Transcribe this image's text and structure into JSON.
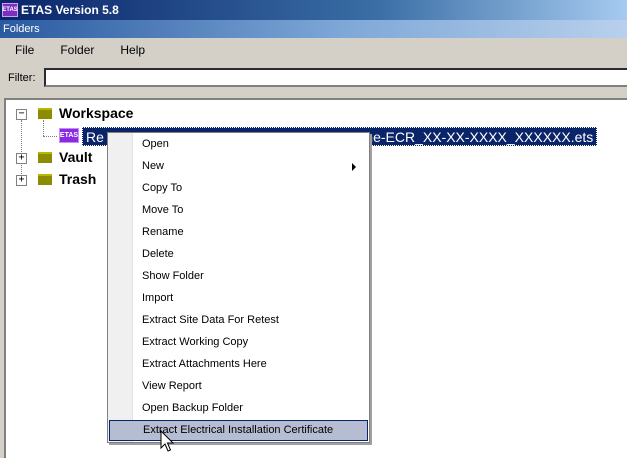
{
  "window": {
    "title": "ETAS Version 5.8",
    "logo_text": "ETAS"
  },
  "panel": {
    "title": "Folders"
  },
  "menu": {
    "items": [
      "File",
      "Folder",
      "Help"
    ]
  },
  "filter": {
    "label": "Filter:",
    "value": "",
    "placeholder": ""
  },
  "tree": {
    "workspace": {
      "label": "Workspace",
      "expander": "−"
    },
    "selected_file": {
      "icon_text": "ETAS",
      "label": "Re                                                              ourne-ECR_XX-XX-XXXX_XXXXXX.ets"
    },
    "vault": {
      "label": "Vault",
      "expander": "+"
    },
    "trash": {
      "label": "Trash",
      "expander": "+"
    }
  },
  "context_menu": {
    "items": [
      {
        "label": "Open"
      },
      {
        "label": "New",
        "submenu": true
      },
      {
        "label": "Copy To"
      },
      {
        "label": "Move To"
      },
      {
        "label": "Rename"
      },
      {
        "label": "Delete"
      },
      {
        "label": "Show Folder"
      },
      {
        "label": "Import"
      },
      {
        "label": "Extract Site Data For Retest"
      },
      {
        "label": "Extract Working Copy"
      },
      {
        "label": "Extract Attachments Here"
      },
      {
        "label": "View Report"
      },
      {
        "label": "Open Backup Folder"
      },
      {
        "label": "Extract Electrical Installation Certificate",
        "highlighted": true
      }
    ]
  },
  "colors": {
    "selection": "#0a246a",
    "menu_highlight": "#b6bdd2",
    "folder": "#8c8c00",
    "etas_icon": "#8a2be2"
  }
}
